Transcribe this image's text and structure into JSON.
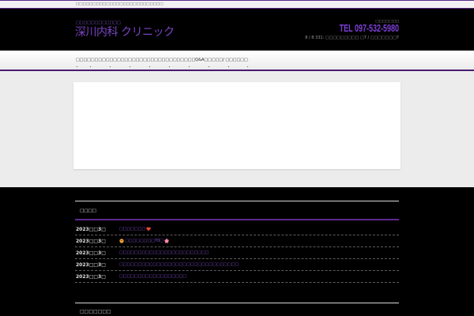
{
  "colors": {
    "accent_purple": "#7a45c4",
    "tel_purple": "#7d3fd6",
    "page_background": "#000000",
    "content_background": "#ececec"
  },
  "topbar": {
    "text": "□□□□□□□□□□□□□□□□□□□□□□□□□□"
  },
  "header": {
    "tagline": "□□□□□□□□□□□□",
    "logo": "深川内科 クリニック",
    "contact_note": "□□□□□□□",
    "tel": "TEL 097-532-5980",
    "hours": "8 / 8 331: □□□□□□□□□ □7 / □□□□□□□7"
  },
  "nav": {
    "text": "□□□□□□□□□□□□□□□□□□□□□□□□□□□□□□□□Q&A□□□□□/ □□□□□□"
  },
  "news": {
    "heading": "□□□□",
    "items": [
      {
        "date": "2023□□3□",
        "title": "□□□□□□□",
        "icon_after": "heart-icon"
      },
      {
        "date": "2023□□3□",
        "icon_before": "face-icon",
        "title": "□□□□□□□□70□",
        "icon_after": "blossom-icon"
      },
      {
        "date": "2023□□3□",
        "title": "□□□□□□□□□□□□□□□□□□□□□□□□"
      },
      {
        "date": "2023□□3□",
        "title": "□□□□□□□□□□□□□□□□□□□□□□□□□□□□□□□□"
      },
      {
        "date": "2023□□3□",
        "title": "□□□□□□□□□□□□□□□□□□"
      }
    ]
  },
  "footer": {
    "heading": "□□□□□□□"
  }
}
